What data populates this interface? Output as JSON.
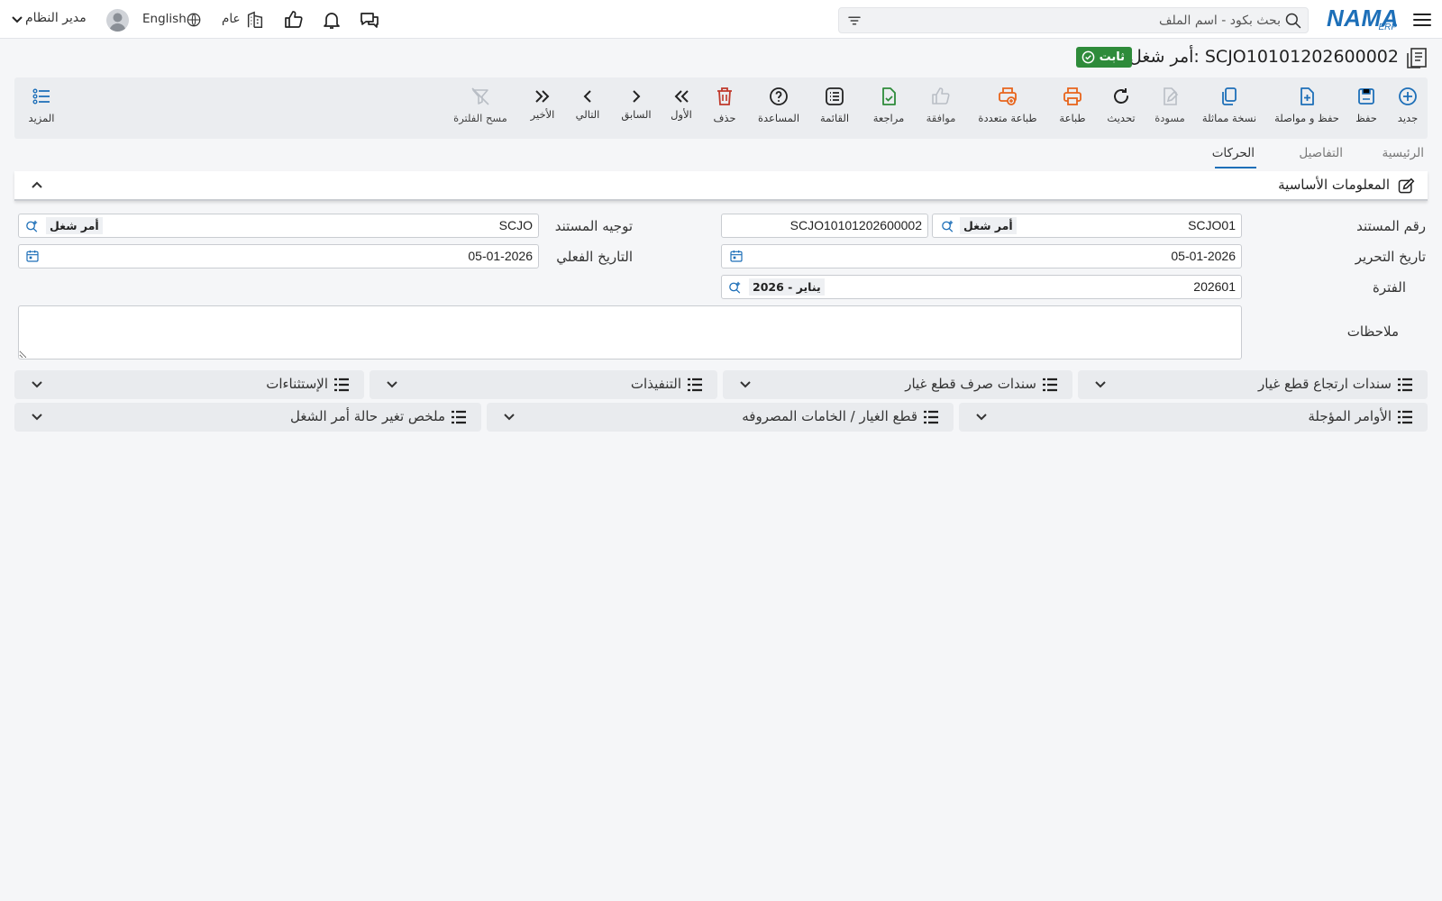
{
  "header": {
    "logo_text": "NAMA",
    "logo_sub": "ERP",
    "search_placeholder": "بحث بكود - اسم الملف",
    "user_name": "مدير النظام",
    "language": "English",
    "company": "عام"
  },
  "document": {
    "title": "أمر شغل: SCJO10101202600002",
    "status": "ثابت"
  },
  "toolbar": {
    "new": "جديد",
    "save": "حفظ",
    "save_continue": "حفظ و مواصلة",
    "duplicate": "نسخة مماثلة",
    "draft": "مسودة",
    "refresh": "تحديث",
    "print": "طباعة",
    "multi_print": "طباعة متعددة",
    "approve": "موافقة",
    "review": "مراجعة",
    "list": "القائمة",
    "help": "المساعدة",
    "delete": "حذف",
    "first": "الأول",
    "previous": "السابق",
    "next": "التالي",
    "last": "الأخير",
    "clear_filter": "مسح الفلترة",
    "more": "المزيد"
  },
  "tabs": {
    "main": "الرئيسية",
    "details": "التفاصيل",
    "movements": "الحركات",
    "active": "movements"
  },
  "section": {
    "title": "المعلومات الأساسية"
  },
  "form": {
    "doc_number_label": "رقم المستند",
    "doc_number_book": "SCJO01",
    "doc_number_book_tag": "أمر شغل",
    "doc_number_code": "SCJO10101202600002",
    "doc_direction_label": "توجيه المستند",
    "doc_direction_value": "SCJO",
    "doc_direction_tag": "أمر شغل",
    "issue_date_label": "تاريخ التحرير",
    "issue_date_value": "05-01-2026",
    "actual_date_label": "التاريخ الفعلي",
    "actual_date_value": "05-01-2026",
    "period_label": "الفترة",
    "period_value": "202601",
    "period_tag": "2026 - يناير",
    "notes_label": "ملاحظات",
    "notes_value": ""
  },
  "panels": {
    "spare_returns": "سندات ارتجاع قطع غيار",
    "spare_issues": "سندات صرف قطع غيار",
    "executions": "التنفيذات",
    "exceptions": "الإستثناءات",
    "deferred_orders": "الأوامر المؤجلة",
    "spare_parts_consumed": "قطع الغيار / الخامات المصروفه",
    "status_change_summary": "ملخص تغير حالة أمر الشغل"
  },
  "colors": {
    "brand": "#1d6fb8",
    "status_green": "#2e8b3a",
    "print_orange": "#e8641b",
    "delete_red": "#c0392b",
    "review_green": "#2e8b3a"
  },
  "icons": {
    "menu": "hamburger-icon",
    "search": "search-icon",
    "filter": "filter-icon",
    "user": "avatar",
    "globe": "globe-icon",
    "company": "building-icon",
    "like": "thumbs-up-icon",
    "bell": "bell-icon",
    "chat": "chat-icon"
  }
}
